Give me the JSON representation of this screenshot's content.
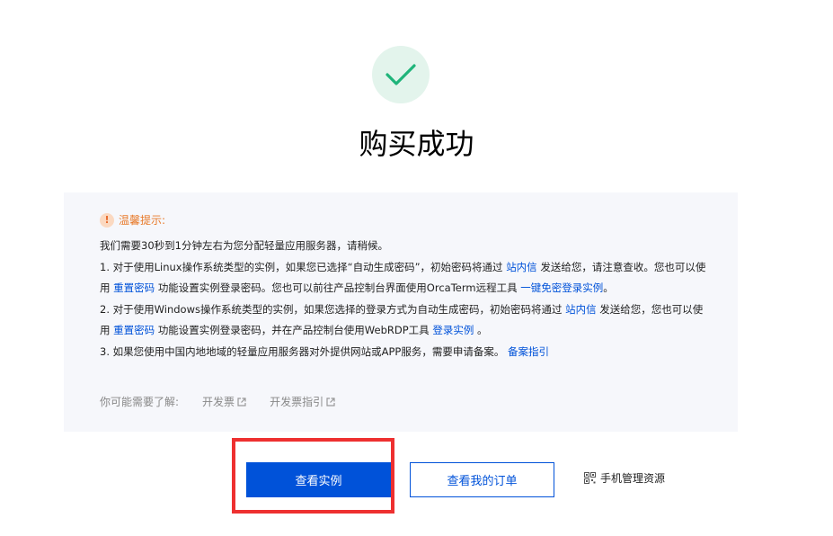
{
  "title": "购买成功",
  "notice": {
    "heading": "温馨提示:",
    "intro": "我们需要30秒到1分钟左右为您分配轻量应用服务器，请稍候。",
    "item1": {
      "part1": "1. 对于使用Linux操作系统类型的实例，如果您已选择“自动生成密码”，初始密码将通过",
      "link1": "站内信",
      "part2": "发送给您，请注意查收。您也可以使用",
      "link2": "重置密码",
      "part3": "功能设置实例登录密码。您也可以前往产品控制台界面使用OrcaTerm远程工具",
      "link3": "一键免密登录实例",
      "part4": "。"
    },
    "item2": {
      "part1": "2. 对于使用Windows操作系统类型的实例，如果您选择的登录方式为自动生成密码，初始密码将通过",
      "link1": "站内信",
      "part2": "发送给您，您也可以使用",
      "link2": "重置密码",
      "part3": "功能设置实例登录密码，并在产品控制台使用WebRDP工具",
      "link3": "登录实例",
      "part4": "。"
    },
    "item3": {
      "part1": "3. 如果您使用中国内地地域的轻量应用服务器对外提供网站或APP服务，需要申请备案。",
      "link1": "备案指引"
    },
    "also_label": "你可能需要了解:",
    "also_links": [
      "开发票",
      "开发票指引"
    ]
  },
  "actions": {
    "view_instance": "查看实例",
    "view_orders": "查看我的订单",
    "mobile_manage": "手机管理资源"
  },
  "colors": {
    "primary": "#0052d9",
    "success": "#1fb47a",
    "warning": "#e87a2a",
    "highlight": "#ee3030"
  }
}
